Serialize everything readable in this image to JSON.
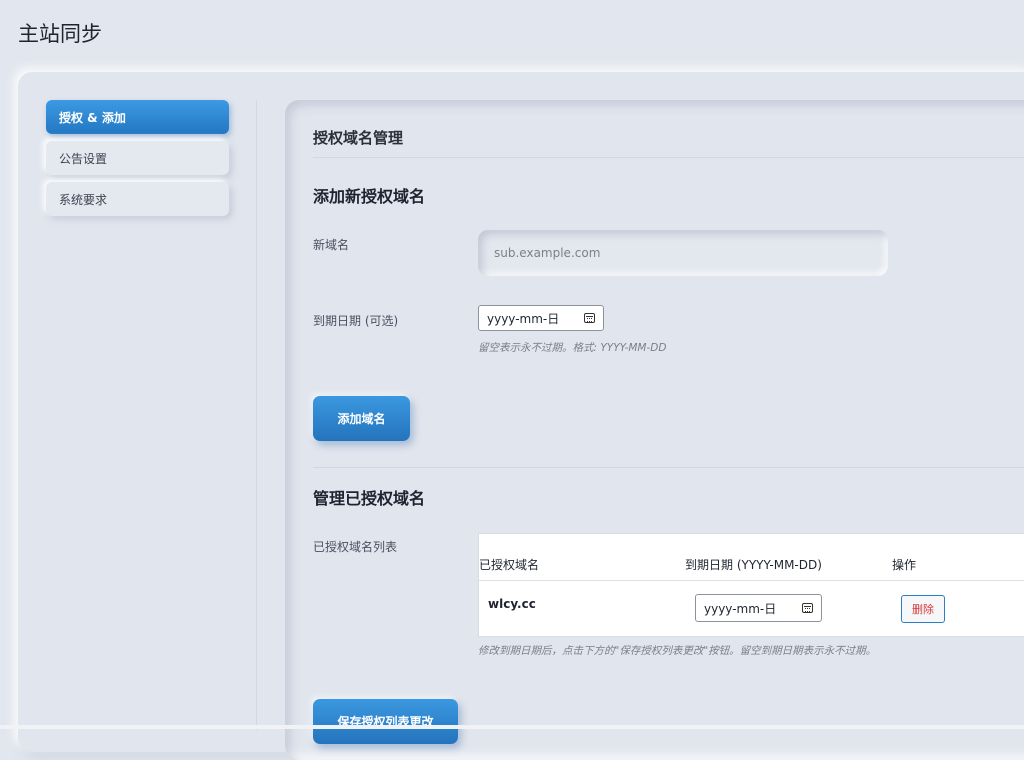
{
  "page": {
    "title": "主站同步"
  },
  "sidebar": {
    "items": [
      {
        "label": "授权 & 添加",
        "active": true
      },
      {
        "label": "公告设置",
        "active": false
      },
      {
        "label": "系统要求",
        "active": false
      }
    ]
  },
  "main": {
    "heading": "授权域名管理",
    "add_section": {
      "title": "添加新授权域名",
      "domain_label": "新域名",
      "domain_placeholder": "sub.example.com",
      "domain_value": "",
      "expiry_label": "到期日期 (可选)",
      "expiry_value": "yyyy-mm-日",
      "expiry_hint": "留空表示永不过期。格式: YYYY-MM-DD",
      "add_button": "添加域名"
    },
    "manage_section": {
      "title": "管理已授权域名",
      "list_label": "已授权域名列表",
      "columns": [
        "已授权域名",
        "到期日期 (YYYY-MM-DD)",
        "操作"
      ],
      "rows": [
        {
          "domain": "wlcy.cc",
          "expiry": "yyyy-mm-日",
          "action": "删除"
        }
      ],
      "hint": "修改到期日期后，点击下方的\"保存授权列表更改\"按钮。留空到期日期表示永不过期。",
      "save_button": "保存授权列表更改"
    }
  },
  "icons": {
    "date_picker": "calendar-icon"
  },
  "colors": {
    "accent": "#2b86d3",
    "danger": "#d63638",
    "background": "#e2e6ee"
  }
}
